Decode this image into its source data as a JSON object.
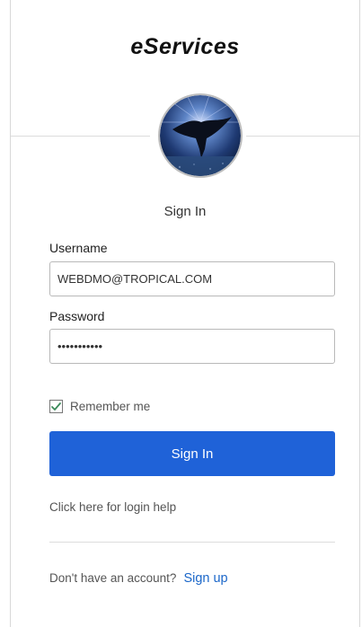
{
  "brand": {
    "title": "eServices"
  },
  "form": {
    "heading": "Sign In",
    "username_label": "Username",
    "username_value": "WEBDMO@TROPICAL.COM",
    "password_label": "Password",
    "password_value": "•••••••••••",
    "remember_label": "Remember me",
    "remember_checked": true,
    "submit_label": "Sign In"
  },
  "links": {
    "help": "Click here for login help",
    "no_account": "Don't have an account?",
    "signup": "Sign up"
  },
  "colors": {
    "primary_button": "#1f62d8",
    "link": "#1a66c9",
    "check": "#3b8a5a"
  },
  "icons": {
    "avatar": "manta-ray-logo",
    "checkbox": "checkmark-icon"
  }
}
